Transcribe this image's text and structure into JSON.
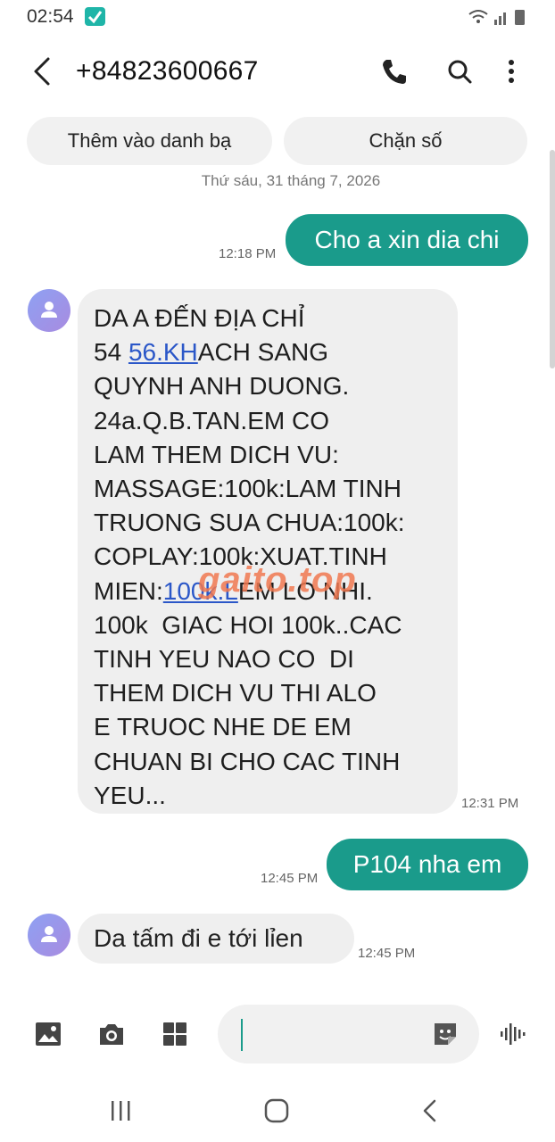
{
  "status": {
    "time": "02:54"
  },
  "header": {
    "contact": "+84823600667"
  },
  "actions": {
    "add_contact": "Thêm vào danh bạ",
    "block": "Chặn số"
  },
  "date_separator": "Thứ sáu, 31 tháng 7, 2026",
  "messages": [
    {
      "direction": "out",
      "text": "Cho a xin dia chi",
      "time": "12:18 PM"
    },
    {
      "direction": "in",
      "lines": [
        "DA A ĐẾN ĐỊA CHỈ",
        "54 ",
        "56.KH",
        "ACH SANG",
        "QUYNH ANH DUONG.",
        "24a.Q.B.TAN.EM CO",
        "LAM THEM DICH VU:",
        "MASSAGE:100k:LAM TINH",
        "TRUONG SUA CHUA:100k:",
        "COPLAY:100k:XUAT.TINH",
        "MIEN:",
        "100k.L",
        "EM LO NHI.",
        "100k  GIAC HOI 100k..CAC",
        "TINH YEU NAO CO  DI",
        "THEM DICH VU THI ALO",
        "E TRUOC NHE DE EM",
        "CHUAN BI CHO CAC TINH",
        "YEU..."
      ],
      "time": "12:31 PM"
    },
    {
      "direction": "out",
      "text": "P104 nha em",
      "time": "12:45 PM"
    },
    {
      "direction": "in",
      "text": "Da tấm đi e tới lỉen",
      "time": "12:45 PM"
    }
  ],
  "watermark": "gaito.top",
  "colors": {
    "outgoing_bubble": "#1a9b8b",
    "incoming_bubble": "#efefef",
    "link": "#2b57c8",
    "accent": "#1a9b8b"
  },
  "icons": [
    "back-arrow-icon",
    "phone-icon",
    "search-icon",
    "more-vert-icon",
    "gallery-icon",
    "camera-icon",
    "apps-icon",
    "sticker-icon",
    "voice-icon",
    "recents-icon",
    "home-icon",
    "nav-back-icon"
  ]
}
